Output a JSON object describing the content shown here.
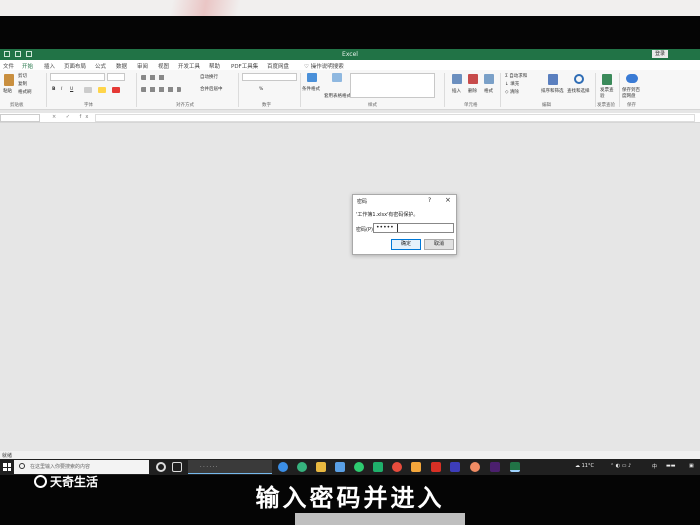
{
  "window": {
    "title": "Excel",
    "login_label": "登录"
  },
  "tabs": [
    "文件",
    "开始",
    "插入",
    "页面布局",
    "公式",
    "数据",
    "审阅",
    "视图",
    "开发工具",
    "帮助",
    "PDF工具集",
    "百度网盘"
  ],
  "active_tab": "开始",
  "tell_me": "操作说明搜索",
  "ribbon": {
    "groups": [
      "剪贴板",
      "字体",
      "对齐方式",
      "数字",
      "样式",
      "单元格",
      "编辑",
      "发票查验",
      "保存"
    ],
    "clipboard": {
      "paste": "粘贴",
      "cut": "剪切",
      "copy": "复制",
      "format_painter": "格式刷"
    },
    "font": {
      "bold": "B",
      "italic": "I",
      "underline": "U"
    },
    "alignment": {
      "wrap": "自动换行",
      "merge": "合并后居中"
    },
    "number": {
      "percent": "%"
    },
    "styles": {
      "conditional": "条件格式",
      "table": "套用表格格式"
    },
    "cells": {
      "insert": "插入",
      "delete": "删除",
      "format": "格式"
    },
    "editing": {
      "autosum": "自动求和",
      "fill": "填充",
      "clear": "清除",
      "sort": "排序和筛选",
      "find": "查找和选择"
    },
    "invoice": {
      "check": "发票查验"
    },
    "save": {
      "baidu": "保存到百度网盘"
    }
  },
  "formula_bar": {
    "fx": "× ✓ fx"
  },
  "sheet_status": "就绪",
  "dialog": {
    "title": "密码",
    "help": "?",
    "close": "×",
    "message": "'工作簿1.xlsx'有密码保护。",
    "password_label": "密码(P):",
    "password_value": "•••••",
    "ok": "确定",
    "cancel": "取消"
  },
  "taskbar": {
    "search_placeholder": "在这里输入你要搜索的内容",
    "temperature": "11°C",
    "ime": "中"
  },
  "overlay": {
    "watermark": "天奇生活",
    "subtitle": "输入密码并进入"
  },
  "colors": {
    "excel_green": "#217346",
    "taskbar": "#202020",
    "dialog_accent": "#0078d7"
  }
}
